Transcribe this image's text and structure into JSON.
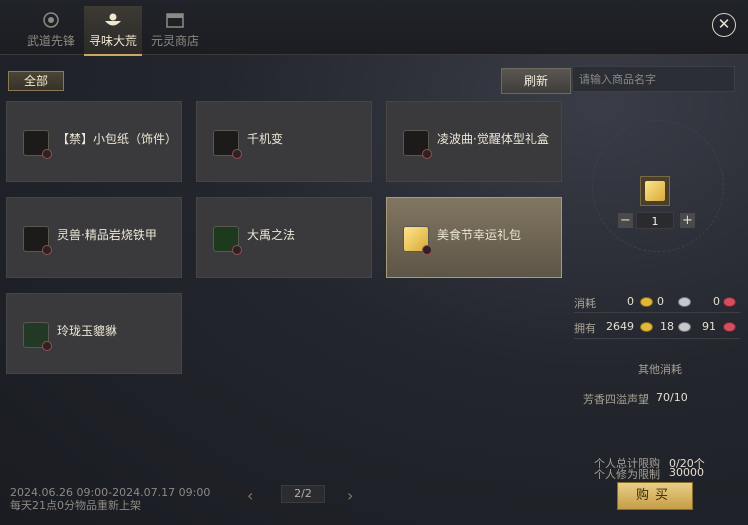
{
  "tabs": [
    {
      "label": "武道先锋",
      "icon": "crest-icon",
      "active": false
    },
    {
      "label": "寻味大荒",
      "icon": "food-icon",
      "active": true
    },
    {
      "label": "元灵商店",
      "icon": "shop-icon",
      "active": false
    }
  ],
  "filter": {
    "label": "全部"
  },
  "toolbar": {
    "refresh_label": "刷新"
  },
  "search": {
    "placeholder": "请输入商品名字",
    "value": ""
  },
  "items": [
    {
      "name": "【禁】小包纸（饰件）",
      "icon": "package-icon"
    },
    {
      "name": "千机变",
      "icon": "gear-icon"
    },
    {
      "name": "凌波曲·觉醒体型礼盒",
      "icon": "figure-icon"
    },
    {
      "name": "灵兽·精品岩烧铁甲",
      "icon": "beast-icon"
    },
    {
      "name": "大禹之法",
      "icon": "jade-icon"
    },
    {
      "name": "美食节幸运礼包",
      "icon": "gold-box-icon",
      "selected": true
    },
    {
      "name": "玲珑玉貔貅",
      "icon": "jade-beast-icon"
    }
  ],
  "detail": {
    "quantity": "1",
    "minus_label": "−",
    "plus_label": "+",
    "cost_label": "消耗",
    "cost": [
      "0",
      "0",
      "0"
    ],
    "own_label": "拥有",
    "own": [
      "2649",
      "18",
      "91"
    ],
    "currency_colors": [
      "#e0b93b",
      "#c7c8cc",
      "#d24f5f"
    ],
    "other_cost_label": "其他消耗",
    "reputation_label": "芳香四溢声望",
    "reputation_value": "70/10",
    "limit_total_label": "个人总计限购",
    "limit_total_value": "0/20个",
    "cultivation_label": "个人修为限制",
    "cultivation_value": "30000",
    "buy_label": "购买"
  },
  "pager": {
    "current": "2/2",
    "prev": "‹",
    "next": "›"
  },
  "footer": {
    "date_range": "2024.06.26 09:00-2024.07.17 09:00",
    "restock_note": "每天21点0分物品重新上架"
  }
}
